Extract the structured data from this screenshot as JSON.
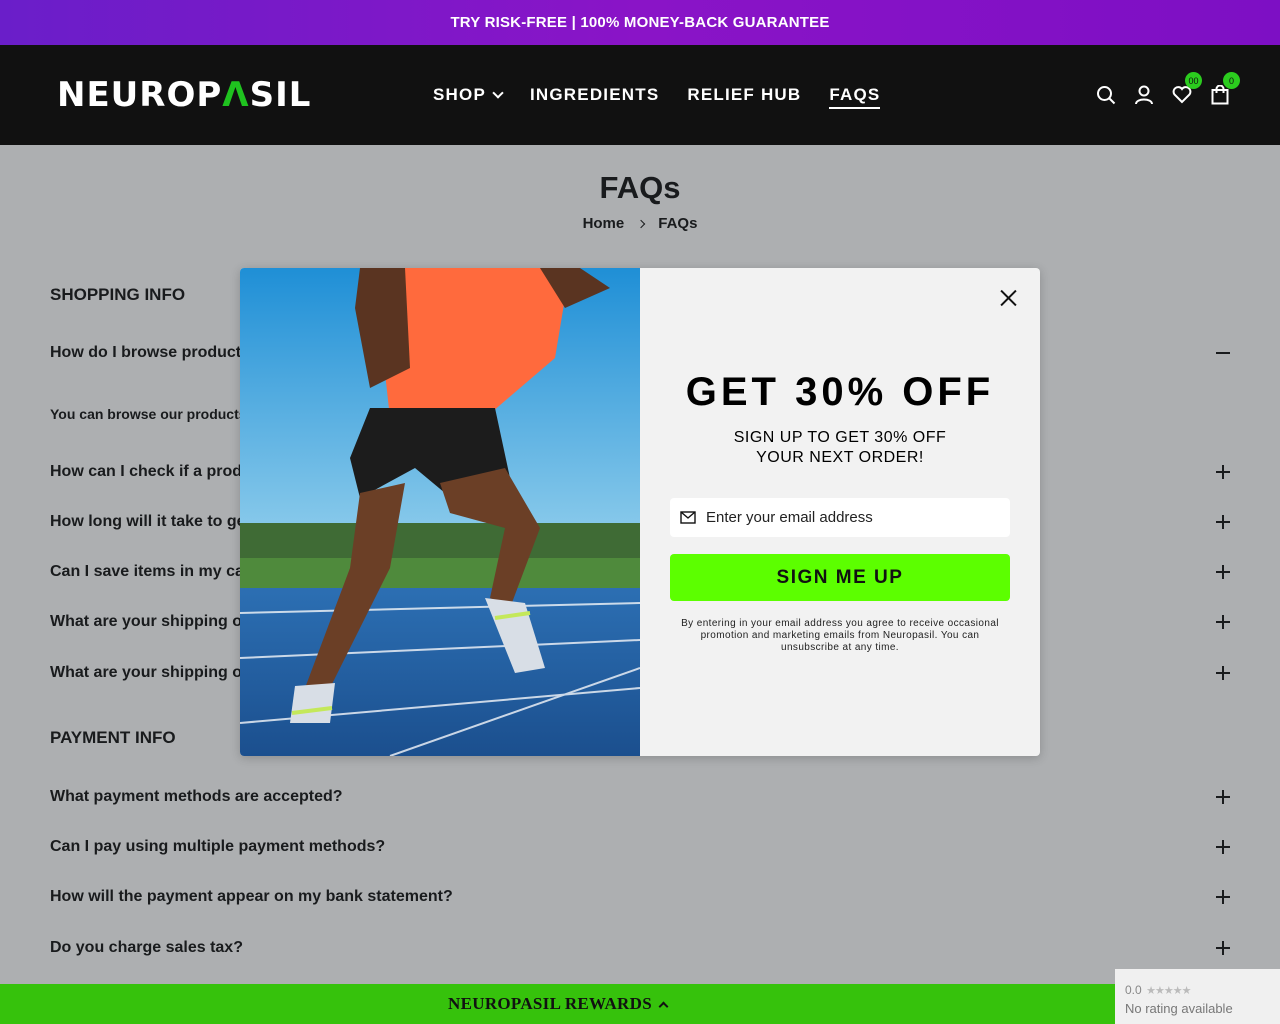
{
  "announcement": "TRY RISK-FREE | 100% MONEY-BACK GUARANTEE",
  "brand": {
    "logo_pre": "NEUROP",
    "logo_accent": "Λ",
    "logo_post": "SIL"
  },
  "nav": {
    "shop": "SHOP",
    "ingredients": "INGREDIENTS",
    "relief_hub": "RELIEF HUB",
    "faqs": "FAQS"
  },
  "header_icons": {
    "search": "search-icon",
    "account": "user-icon",
    "wishlist": "heart-icon",
    "cart": "bag-icon",
    "wishlist_count": "00",
    "cart_count": "0"
  },
  "page": {
    "title": "FAQs",
    "breadcrumb_home": "Home",
    "breadcrumb_current": "FAQs"
  },
  "shopping": {
    "title": "SHOPPING INFO",
    "q1": "How do I browse products?",
    "a1": "You can browse our products by using the shop menu at the top of the page.",
    "q2": "How can I check if a product is in stock?",
    "q3": "How long will it take to get my order?",
    "q4": "Can I save items in my cart for later?",
    "q5": "What are your shipping options?",
    "q6": "What are your shipping options internationally?"
  },
  "payment": {
    "title": "PAYMENT INFO",
    "q1": "What payment methods are accepted?",
    "q2": "Can I pay using multiple payment methods?",
    "q3": "How will the payment appear on my bank statement?",
    "q4": "Do you charge sales tax?"
  },
  "modal": {
    "title": "GET 30% OFF",
    "subtitle_line1": "SIGN UP TO GET 30% OFF",
    "subtitle_line2": "YOUR NEXT ORDER!",
    "email_placeholder": "Enter your email address",
    "button": "SIGN ME UP",
    "disclaimer": "By entering in your email address you agree to receive occasional promotion and marketing emails from Neuropasil. You can unsubscribe at any time."
  },
  "rewards": {
    "label": "NEUROPASIL REWARDS"
  },
  "rating": {
    "score": "0.0",
    "stars": "★★★★★",
    "text": "No rating available"
  },
  "colors": {
    "accent_green": "#5cff00",
    "rewards_green": "#36c20c",
    "announcement_purple": "#7a17c7",
    "header_bg": "#111111"
  }
}
